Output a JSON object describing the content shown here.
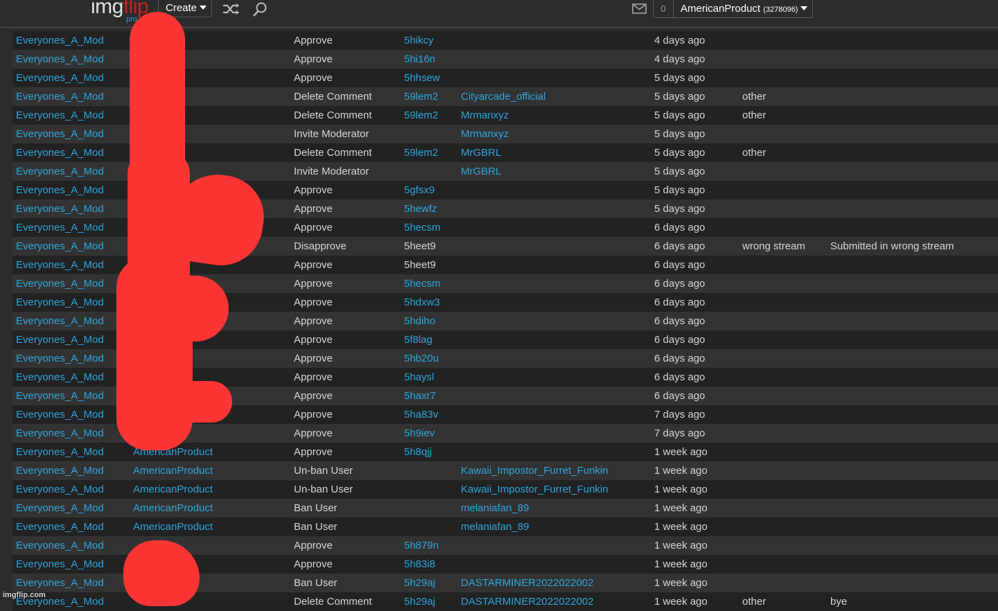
{
  "header": {
    "logo_main": "img",
    "logo_accent": "flip",
    "logo_badge": "pro",
    "create_label": "Create",
    "icons": [
      "shuffle-icon",
      "search-icon",
      "mail-icon"
    ],
    "notification_count": "0",
    "username": "AmericanProduct",
    "user_points": "(3278096)"
  },
  "colors": {
    "link": "#2fa4db",
    "logo_accent": "#c8201e",
    "row_dark": "#222222",
    "row_light": "#333333",
    "redaction": "#fb3434"
  },
  "rows": [
    {
      "mod": "Everyones_A_Mod",
      "user": "",
      "action": "Approve",
      "post": "5hikcy",
      "post_link": true,
      "target": "",
      "time": "4 days ago",
      "reason": "",
      "note": ""
    },
    {
      "mod": "Everyones_A_Mod",
      "user": "",
      "action": "Approve",
      "post": "5hi16n",
      "post_link": true,
      "target": "",
      "time": "4 days ago",
      "reason": "",
      "note": ""
    },
    {
      "mod": "Everyones_A_Mod",
      "user": "",
      "action": "Approve",
      "post": "5hhsew",
      "post_link": true,
      "target": "",
      "time": "5 days ago",
      "reason": "",
      "note": ""
    },
    {
      "mod": "Everyones_A_Mod",
      "user": "",
      "action": "Delete Comment",
      "post": "59lem2",
      "post_link": true,
      "target": "Cityarcade_official",
      "time": "5 days ago",
      "reason": "other",
      "note": ""
    },
    {
      "mod": "Everyones_A_Mod",
      "user": "",
      "action": "Delete Comment",
      "post": "59lem2",
      "post_link": true,
      "target": "Mrmanxyz",
      "time": "5 days ago",
      "reason": "other",
      "note": ""
    },
    {
      "mod": "Everyones_A_Mod",
      "user": "",
      "action": "Invite Moderator",
      "post": "",
      "post_link": false,
      "target": "Mrmanxyz",
      "time": "5 days ago",
      "reason": "",
      "note": ""
    },
    {
      "mod": "Everyones_A_Mod",
      "user": "",
      "action": "Delete Comment",
      "post": "59lem2",
      "post_link": true,
      "target": "MrGBRL",
      "time": "5 days ago",
      "reason": "other",
      "note": ""
    },
    {
      "mod": "Everyones_A_Mod",
      "user": "",
      "action": "Invite Moderator",
      "post": "",
      "post_link": false,
      "target": "MrGBRL",
      "time": "5 days ago",
      "reason": "",
      "note": ""
    },
    {
      "mod": "Everyones_A_Mod",
      "user": "",
      "action": "Approve",
      "post": "5gfsx9",
      "post_link": true,
      "target": "",
      "time": "5 days ago",
      "reason": "",
      "note": ""
    },
    {
      "mod": "Everyones_A_Mod",
      "user": "",
      "action": "Approve",
      "post": "5hewfz",
      "post_link": true,
      "target": "",
      "time": "5 days ago",
      "reason": "",
      "note": ""
    },
    {
      "mod": "Everyones_A_Mod",
      "user": "",
      "action": "Approve",
      "post": "5hecsm",
      "post_link": true,
      "target": "",
      "time": "6 days ago",
      "reason": "",
      "note": ""
    },
    {
      "mod": "Everyones_A_Mod",
      "user": "",
      "action": "Disapprove",
      "post": "5heet9",
      "post_link": false,
      "target": "",
      "time": "6 days ago",
      "reason": "wrong stream",
      "note": "Submitted in wrong stream"
    },
    {
      "mod": "Everyones_A_Mod",
      "user": "",
      "action": "Approve",
      "post": "5heet9",
      "post_link": false,
      "target": "",
      "time": "6 days ago",
      "reason": "",
      "note": ""
    },
    {
      "mod": "Everyones_A_Mod",
      "user": "",
      "action": "Approve",
      "post": "5hecsm",
      "post_link": true,
      "target": "",
      "time": "6 days ago",
      "reason": "",
      "note": ""
    },
    {
      "mod": "Everyones_A_Mod",
      "user": "",
      "action": "Approve",
      "post": "5hdxw3",
      "post_link": true,
      "target": "",
      "time": "6 days ago",
      "reason": "",
      "note": ""
    },
    {
      "mod": "Everyones_A_Mod",
      "user": "",
      "action": "Approve",
      "post": "5hdiho",
      "post_link": true,
      "target": "",
      "time": "6 days ago",
      "reason": "",
      "note": ""
    },
    {
      "mod": "Everyones_A_Mod",
      "user": "",
      "action": "Approve",
      "post": "5f8lag",
      "post_link": true,
      "target": "",
      "time": "6 days ago",
      "reason": "",
      "note": ""
    },
    {
      "mod": "Everyones_A_Mod",
      "user": "",
      "action": "Approve",
      "post": "5hb20u",
      "post_link": true,
      "target": "",
      "time": "6 days ago",
      "reason": "",
      "note": ""
    },
    {
      "mod": "Everyones_A_Mod",
      "user": "",
      "action": "Approve",
      "post": "5haysl",
      "post_link": true,
      "target": "",
      "time": "6 days ago",
      "reason": "",
      "note": ""
    },
    {
      "mod": "Everyones_A_Mod",
      "user": "",
      "action": "Approve",
      "post": "5haxr7",
      "post_link": true,
      "target": "",
      "time": "6 days ago",
      "reason": "",
      "note": ""
    },
    {
      "mod": "Everyones_A_Mod",
      "user": "",
      "action": "Approve",
      "post": "5ha83v",
      "post_link": true,
      "target": "",
      "time": "7 days ago",
      "reason": "",
      "note": ""
    },
    {
      "mod": "Everyones_A_Mod",
      "user": "",
      "action": "Approve",
      "post": "5h9iev",
      "post_link": true,
      "target": "",
      "time": "7 days ago",
      "reason": "",
      "note": ""
    },
    {
      "mod": "Everyones_A_Mod",
      "user": "AmericanProduct",
      "action": "Approve",
      "post": "5h8qjj",
      "post_link": true,
      "target": "",
      "time": "1 week ago",
      "reason": "",
      "note": ""
    },
    {
      "mod": "Everyones_A_Mod",
      "user": "AmericanProduct",
      "action": "Un-ban User",
      "post": "",
      "post_link": false,
      "target": "Kawaii_Impostor_Furret_Funkin",
      "time": "1 week ago",
      "reason": "",
      "note": ""
    },
    {
      "mod": "Everyones_A_Mod",
      "user": "AmericanProduct",
      "action": "Un-ban User",
      "post": "",
      "post_link": false,
      "target": "Kawaii_Impostor_Furret_Funkin",
      "time": "1 week ago",
      "reason": "",
      "note": ""
    },
    {
      "mod": "Everyones_A_Mod",
      "user": "AmericanProduct",
      "action": "Ban User",
      "post": "",
      "post_link": false,
      "target": "melaniafan_89",
      "time": "1 week ago",
      "reason": "",
      "note": ""
    },
    {
      "mod": "Everyones_A_Mod",
      "user": "AmericanProduct",
      "action": "Ban User",
      "post": "",
      "post_link": false,
      "target": "melaniafan_89",
      "time": "1 week ago",
      "reason": "",
      "note": ""
    },
    {
      "mod": "Everyones_A_Mod",
      "user": "",
      "action": "Approve",
      "post": "5h879n",
      "post_link": true,
      "target": "",
      "time": "1 week ago",
      "reason": "",
      "note": ""
    },
    {
      "mod": "Everyones_A_Mod",
      "user": "",
      "action": "Approve",
      "post": "5h83i8",
      "post_link": true,
      "target": "",
      "time": "1 week ago",
      "reason": "",
      "note": ""
    },
    {
      "mod": "Everyones_A_Mod",
      "user": "",
      "action": "Ban User",
      "post": "5h29aj",
      "post_link": true,
      "target": "DASTARMINER2022022002",
      "time": "1 week ago",
      "reason": "",
      "note": ""
    },
    {
      "mod": "Everyones_A_Mod",
      "user": "",
      "action": "Delete Comment",
      "post": "5h29aj",
      "post_link": true,
      "target": "DASTARMINER2022022002",
      "time": "1 week ago",
      "reason": "other",
      "note": "bye"
    }
  ],
  "watermark": "imgflip.com"
}
